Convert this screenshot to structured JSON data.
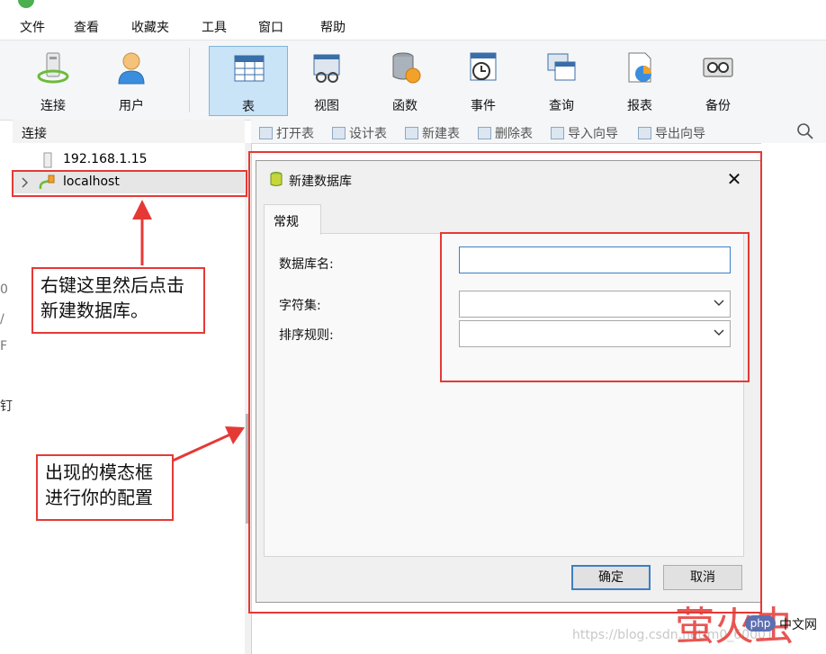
{
  "menu": {
    "items": [
      "文件",
      "查看",
      "收藏夹",
      "工具",
      "窗口",
      "帮助"
    ]
  },
  "toolbar": {
    "buttons": [
      {
        "label": "连接",
        "icon": "connection-icon"
      },
      {
        "label": "用户",
        "icon": "user-icon"
      },
      {
        "label": "表",
        "icon": "table-icon",
        "active": true
      },
      {
        "label": "视图",
        "icon": "view-icon"
      },
      {
        "label": "函数",
        "icon": "function-icon"
      },
      {
        "label": "事件",
        "icon": "event-icon"
      },
      {
        "label": "查询",
        "icon": "query-icon"
      },
      {
        "label": "报表",
        "icon": "report-icon"
      },
      {
        "label": "备份",
        "icon": "backup-icon"
      }
    ],
    "active_color": "#c9e3f7"
  },
  "connections": {
    "header": "连接",
    "items": [
      {
        "label": "192.168.1.15",
        "icon": "server-icon"
      },
      {
        "label": "localhost",
        "icon": "mysql-connection-icon",
        "expandable": true,
        "selected": true
      }
    ]
  },
  "object_toolbar": {
    "items": [
      "打开表",
      "设计表",
      "新建表",
      "删除表",
      "导入向导",
      "导出向导"
    ],
    "search_icon": "search-icon"
  },
  "dialog": {
    "title": "新建数据库",
    "tab": "常规",
    "fields": {
      "db_name_label": "数据库名:",
      "db_name_value": "",
      "charset_label": "字符集:",
      "charset_value": "",
      "collation_label": "排序规则:",
      "collation_value": ""
    },
    "ok_label": "确定",
    "cancel_label": "取消"
  },
  "annotations": {
    "note1": "右键这里然后点击新建数据库。",
    "note2": "出现的模态框进行你的配置",
    "accent": "#e53935"
  },
  "watermark": {
    "url": "https://blog.csdn.net/m0_60001"
  }
}
